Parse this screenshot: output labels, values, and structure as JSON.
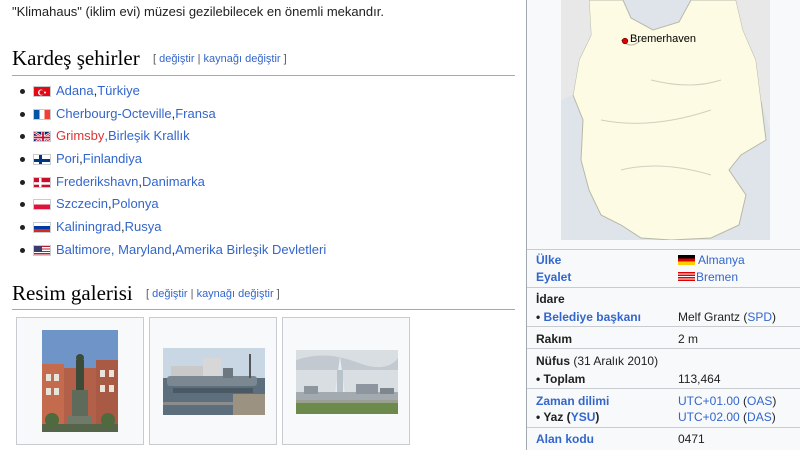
{
  "intro_text": "\"Klimahaus\" (iklim evi) müzesi gezilebilecek en önemli mekandır.",
  "sections": {
    "sister_cities": {
      "title": "Kardeş şehirler",
      "edit": "değiştir",
      "sep": "|",
      "edit_source": "kaynağı değiştir",
      "open": "[",
      "close": "]"
    },
    "gallery": {
      "title": "Resim galerisi",
      "edit": "değiştir",
      "sep": "|",
      "edit_source": "kaynağı değiştir",
      "open": "[",
      "close": "]"
    }
  },
  "sister_cities": [
    {
      "city": "Adana",
      "sep": ", ",
      "country": "Türkiye",
      "flag": "turkey-flag-icon",
      "city_color": "#3366cc"
    },
    {
      "city": "Cherbourg-Octeville",
      "sep": ", ",
      "country": "Fransa",
      "flag": "france-flag-icon",
      "city_color": "#3366cc"
    },
    {
      "city": "Grimsby",
      "sep": ", ",
      "country": "Birleşik Krallık",
      "flag": "uk-flag-icon",
      "city_color": "#dd3333"
    },
    {
      "city": "Pori",
      "sep": ", ",
      "country": "Finlandiya",
      "flag": "finland-flag-icon",
      "city_color": "#3366cc"
    },
    {
      "city": "Frederikshavn",
      "sep": ", ",
      "country": "Danimarka",
      "flag": "denmark-flag-icon",
      "city_color": "#3366cc"
    },
    {
      "city": "Szczecin",
      "sep": ", ",
      "country": "Polonya",
      "flag": "poland-flag-icon",
      "city_color": "#3366cc"
    },
    {
      "city": "Kaliningrad",
      "sep": ", ",
      "country": "Rusya",
      "flag": "russia-flag-icon",
      "city_color": "#3366cc"
    },
    {
      "city": "Baltimore, Maryland",
      "sep": ", ",
      "country": "Amerika Birleşik Devletleri",
      "flag": "usa-flag-icon",
      "city_color": "#3366cc"
    }
  ],
  "gallery": [
    "statue-photo",
    "submarine-harbor-photo",
    "atlantic-hotel-skyline-photo"
  ],
  "infobox": {
    "map_label": "Bremerhaven",
    "country_label": "Ülke",
    "country_value": "Almanya",
    "state_label": "Eyalet",
    "state_value": "Bremen",
    "admin_label": "İdare",
    "mayor_label": "Belediye başkanı",
    "mayor_value": "Melf Grantz",
    "mayor_party": "SPD",
    "elevation_label": "Rakım",
    "elevation_value": "2 m",
    "population_label": "Nüfus",
    "population_date": "(31 Aralık 2010)",
    "total_label": "Toplam",
    "total_value": "113,464",
    "timezone_label": "Zaman dilimi",
    "timezone_value": "UTC+01.00",
    "timezone_abbr": "OAS",
    "summer_label": "Yaz",
    "summer_abbr_label": "YSU",
    "summer_value": "UTC+02.00",
    "summer_abbr": "DAS",
    "area_code_label": "Alan kodu",
    "area_code_value": "0471"
  }
}
